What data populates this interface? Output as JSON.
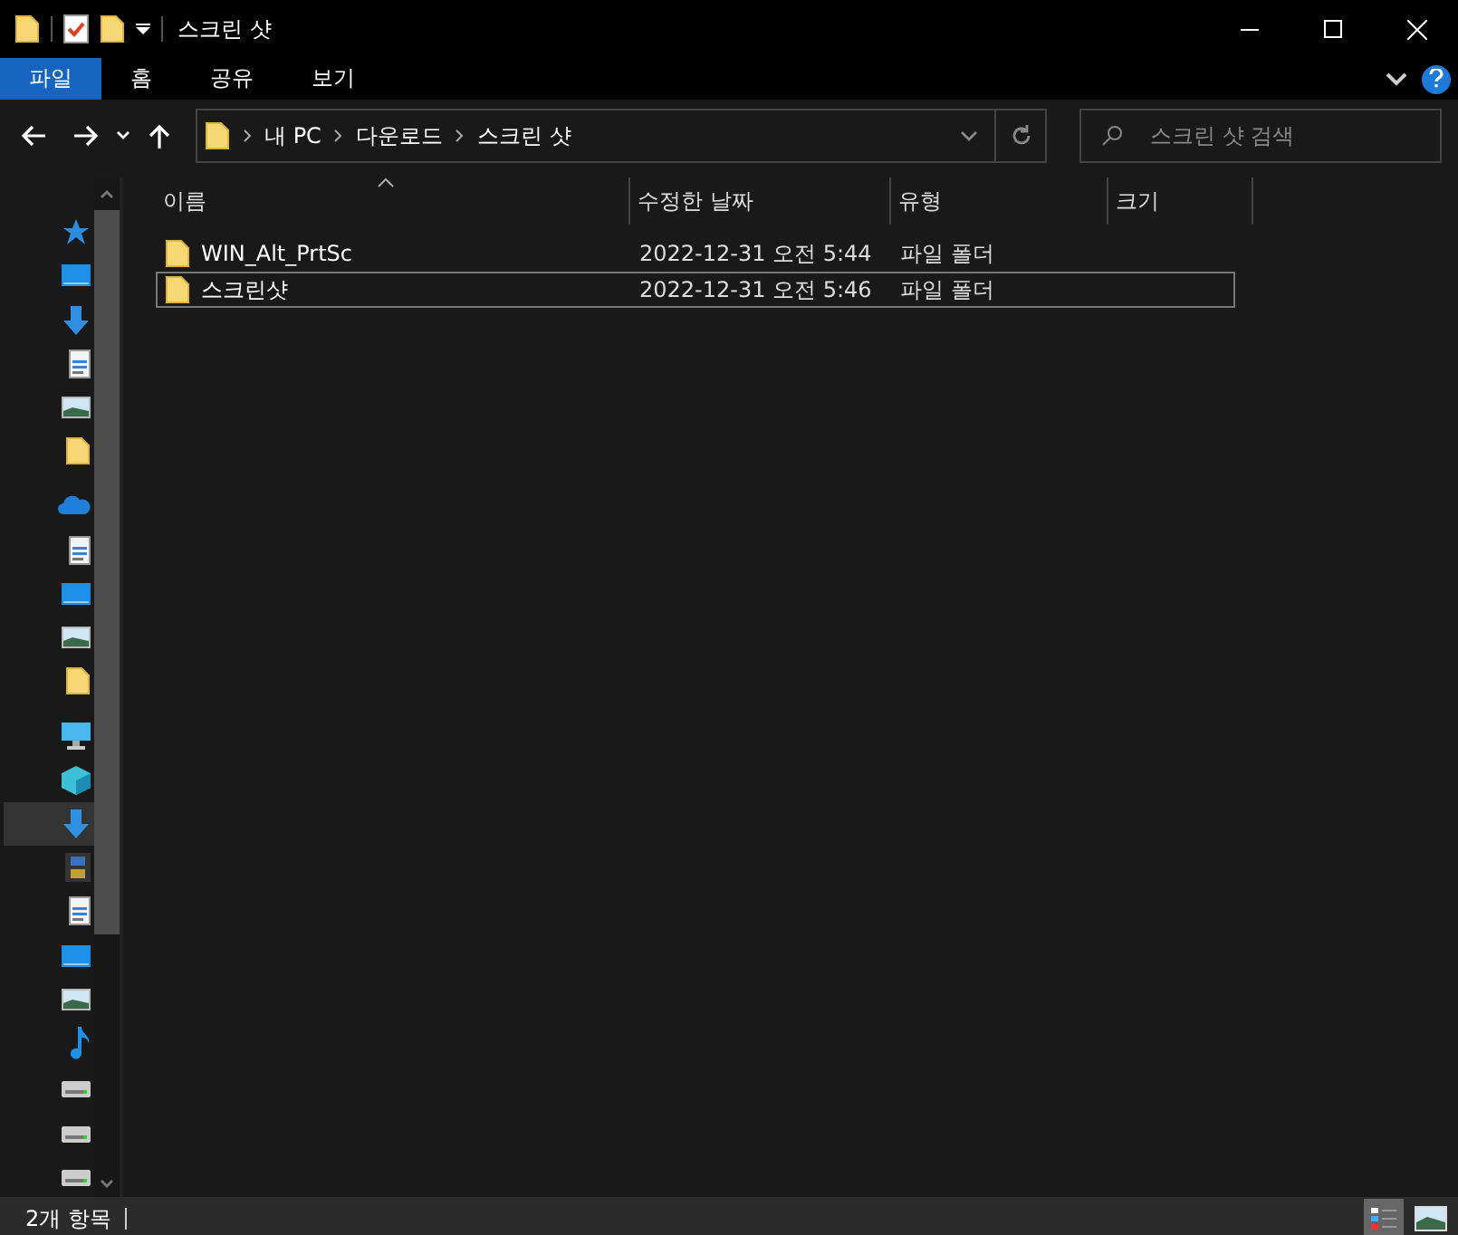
{
  "window": {
    "title": "스크린 샷"
  },
  "ribbon_tabs": [
    {
      "label": "파일",
      "selected": true
    },
    {
      "label": "홈",
      "selected": false
    },
    {
      "label": "공유",
      "selected": false
    },
    {
      "label": "보기",
      "selected": false
    }
  ],
  "address_bar": {
    "crumbs": [
      "내 PC",
      "다운로드",
      "스크린 샷"
    ]
  },
  "search": {
    "placeholder": "스크린 샷 검색"
  },
  "nav_items": [
    {
      "kind": "star",
      "selected": false
    },
    {
      "kind": "desktop",
      "selected": false
    },
    {
      "kind": "download",
      "selected": false
    },
    {
      "kind": "document",
      "selected": false
    },
    {
      "kind": "picture",
      "selected": false
    },
    {
      "kind": "folder",
      "selected": false
    },
    {
      "kind": "cloud",
      "selected": false
    },
    {
      "kind": "document",
      "selected": false
    },
    {
      "kind": "desktop",
      "selected": false
    },
    {
      "kind": "picture",
      "selected": false
    },
    {
      "kind": "folder",
      "selected": false
    },
    {
      "kind": "pc",
      "selected": false
    },
    {
      "kind": "cube",
      "selected": false
    },
    {
      "kind": "download",
      "selected": true
    },
    {
      "kind": "video",
      "selected": false
    },
    {
      "kind": "document",
      "selected": false
    },
    {
      "kind": "desktop",
      "selected": false
    },
    {
      "kind": "picture",
      "selected": false
    },
    {
      "kind": "music",
      "selected": false
    },
    {
      "kind": "drive",
      "selected": false
    },
    {
      "kind": "drive",
      "selected": false
    },
    {
      "kind": "drive",
      "selected": false
    }
  ],
  "table": {
    "columns": [
      "이름",
      "수정한 날짜",
      "유형",
      "크기"
    ],
    "rows": [
      {
        "name": "WIN_Alt_PrtSc",
        "modified": "2022-12-31 오전 5:44",
        "type": "파일 폴더",
        "focused": false
      },
      {
        "name": "스크린샷",
        "modified": "2022-12-31 오전 5:46",
        "type": "파일 폴더",
        "focused": true
      }
    ]
  },
  "status_bar": {
    "count": "2개 항목"
  },
  "view_buttons": [
    {
      "kind": "details",
      "selected": true
    },
    {
      "kind": "thumbnails",
      "selected": false
    }
  ]
}
